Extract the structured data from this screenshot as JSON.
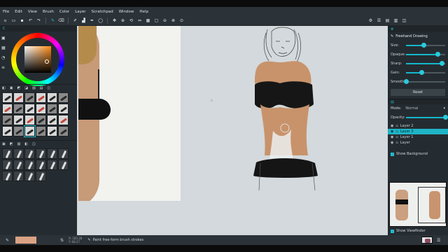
{
  "menu": [
    "File",
    "Edit",
    "View",
    "Brush",
    "Color",
    "Layer",
    "Scratchpad",
    "Window",
    "Help"
  ],
  "toolbar_icons": [
    "new-file-icon",
    "open-icon",
    "save-icon",
    "undo-icon",
    "redo-icon",
    "brush-icon",
    "eraser-icon",
    "smudge-icon",
    "fill-icon",
    "eyedropper-icon",
    "move-icon",
    "zoom-icon",
    "rotate-icon",
    "mirror-icon"
  ],
  "left_panel": {
    "tab_label": "C"
  },
  "right_panel": {
    "brush_settings_title": "Freehand Drawing",
    "sliders": [
      {
        "label": "Size:",
        "value": 0.45
      },
      {
        "label": "Opaque:",
        "value": 0.82
      },
      {
        "label": "Sharp:",
        "value": 0.92
      },
      {
        "label": "Gain:",
        "value": 0.4
      },
      {
        "label": "Smooth:",
        "value": 0.0
      }
    ],
    "reset_label": "Reset",
    "mode_label": "Mode:",
    "mode_value": "Normal",
    "opacity_label": "Opacity:",
    "opacity_value": 1.0,
    "layers": [
      {
        "name": "Layer 2",
        "active": false
      },
      {
        "name": "Layer 3",
        "active": true
      },
      {
        "name": "Layer 1",
        "active": false
      },
      {
        "name": "Layer",
        "active": false
      }
    ],
    "show_background_label": "Show Background",
    "show_viewfinder_label": "Show Viewfinder"
  },
  "status": {
    "message": "Paint free-form brush strokes",
    "coords_x": "X: 185.28",
    "coords_y": "Y: 68.27"
  },
  "colors": {
    "accent": "#26c0d3",
    "current_color": "#d9a284",
    "panel_bg": "#252c31",
    "canvas_bg": "#d3d9dc"
  }
}
